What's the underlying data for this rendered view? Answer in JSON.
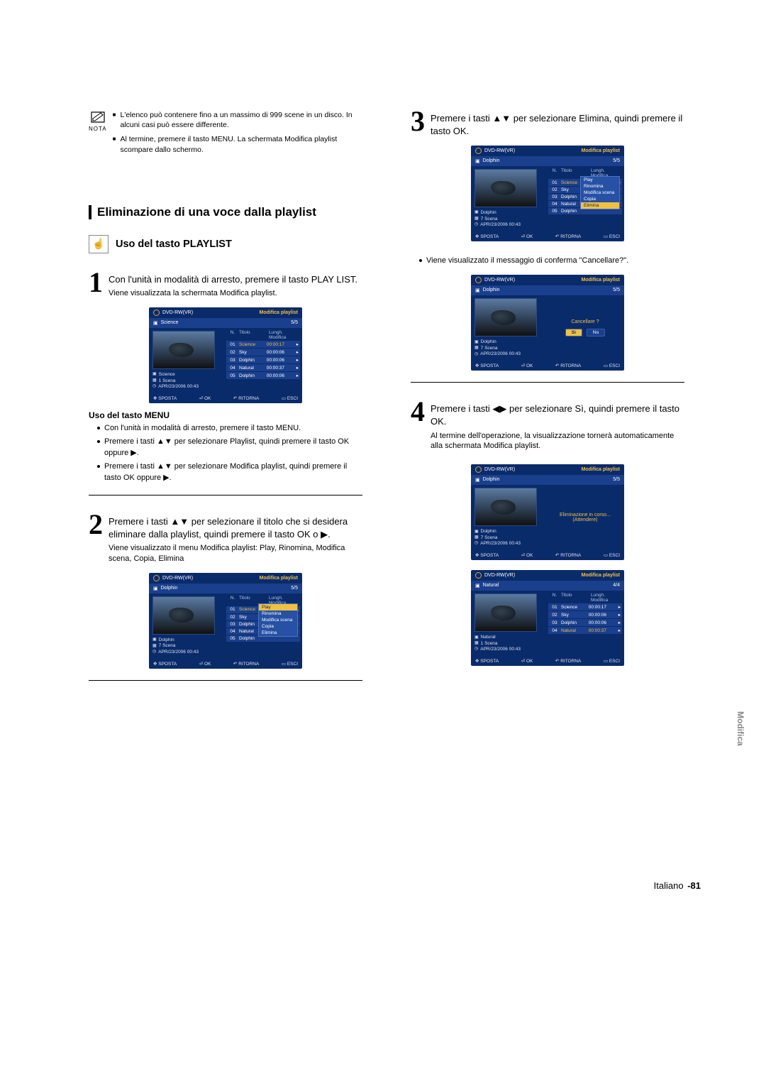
{
  "nota": {
    "label": "NOTA",
    "items": [
      "L'elenco può contenere fino a un massimo di 999 scene in un disco. In alcuni casi può essere differente.",
      "Al termine, premere il tasto MENU. La schermata Modifica playlist scompare dallo schermo."
    ]
  },
  "section_title": "Eliminazione di una voce dalla playlist",
  "hand_subtitle": "Uso del tasto PLAYLIST",
  "steps_left": {
    "1": {
      "text": "Con l'unità in modalità di arresto, premere il tasto PLAY LIST.",
      "sub": "Viene visualizzata la schermata Modifica playlist."
    },
    "menu_heading": "Uso del tasto MENU",
    "menu_bullets": [
      "Con l'unità in modalità di arresto, premere il tasto MENU.",
      "Premere i tasti ▲▼ per selezionare Playlist, quindi premere il tasto OK oppure ▶.",
      "Premere i tasti ▲▼ per selezionare Modifica playlist, quindi premere il tasto OK oppure ▶."
    ],
    "2": {
      "text": "Premere i tasti ▲▼ per selezionare il titolo che si desidera eliminare dalla playlist, quindi premere il tasto OK o ▶.",
      "sub": "Viene visualizzato il menu Modifica playlist: Play, Rinomina, Modifica scena, Copia, Elimina"
    }
  },
  "steps_right": {
    "3": {
      "text": "Premere i tasti ▲▼ per selezionare Elimina, quindi premere il tasto OK."
    },
    "bullet": "Viene visualizzato il messaggio di conferma \"Cancellare?\".",
    "4": {
      "text": "Premere i tasti ◀▶ per selezionare Sì, quindi premere il tasto OK.",
      "sub": "Al termine dell'operazione, la visualizzazione tornerà automaticamente alla schermata Modifica playlist."
    }
  },
  "screens": {
    "disc_label": "DVD-RW(VR)",
    "header_title": "Modifica playlist",
    "counter5": "5/5",
    "counter4": "4/4",
    "cols": {
      "n": "N.",
      "t": "Titolo",
      "l": "Lungh. Modifica"
    },
    "footer": {
      "sposta": "SPOSTA",
      "ok": "OK",
      "ritorna": "RITORNA",
      "esci": "ESCI"
    },
    "info_date": "APR/23/2006 00:43",
    "scene1": "1 Scena",
    "scene7": "7 Scena",
    "name_science": "Science",
    "name_dolphin": "Dolphin",
    "name_natural": "Natural",
    "rows5": [
      {
        "n": "01",
        "t": "Science",
        "l": "00:00:17"
      },
      {
        "n": "02",
        "t": "Sky",
        "l": "00:00:06"
      },
      {
        "n": "03",
        "t": "Dolphin",
        "l": "00:00:06"
      },
      {
        "n": "04",
        "t": "Natural",
        "l": "00:00:37"
      },
      {
        "n": "05",
        "t": "Dolphin",
        "l": "00:00:06"
      }
    ],
    "rows4": [
      {
        "n": "01",
        "t": "Science",
        "l": "00:00:17"
      },
      {
        "n": "02",
        "t": "Sky",
        "l": "00:00:06"
      },
      {
        "n": "03",
        "t": "Dolphin",
        "l": "00:00:06"
      },
      {
        "n": "04",
        "t": "Natural",
        "l": "00:00:37"
      }
    ],
    "ctx_menu": [
      "Play",
      "Rinomina",
      "Modifica scena",
      "Copia",
      "Elimina"
    ],
    "confirm_q": "Cancellare ?",
    "btn_si": "Sì",
    "btn_no": "No",
    "deleting1": "Eliminazione in corso...",
    "deleting2": "(Attendere)"
  },
  "sidebar_label": "Modifica",
  "footer": {
    "lang": "Italiano",
    "page": "-81"
  }
}
